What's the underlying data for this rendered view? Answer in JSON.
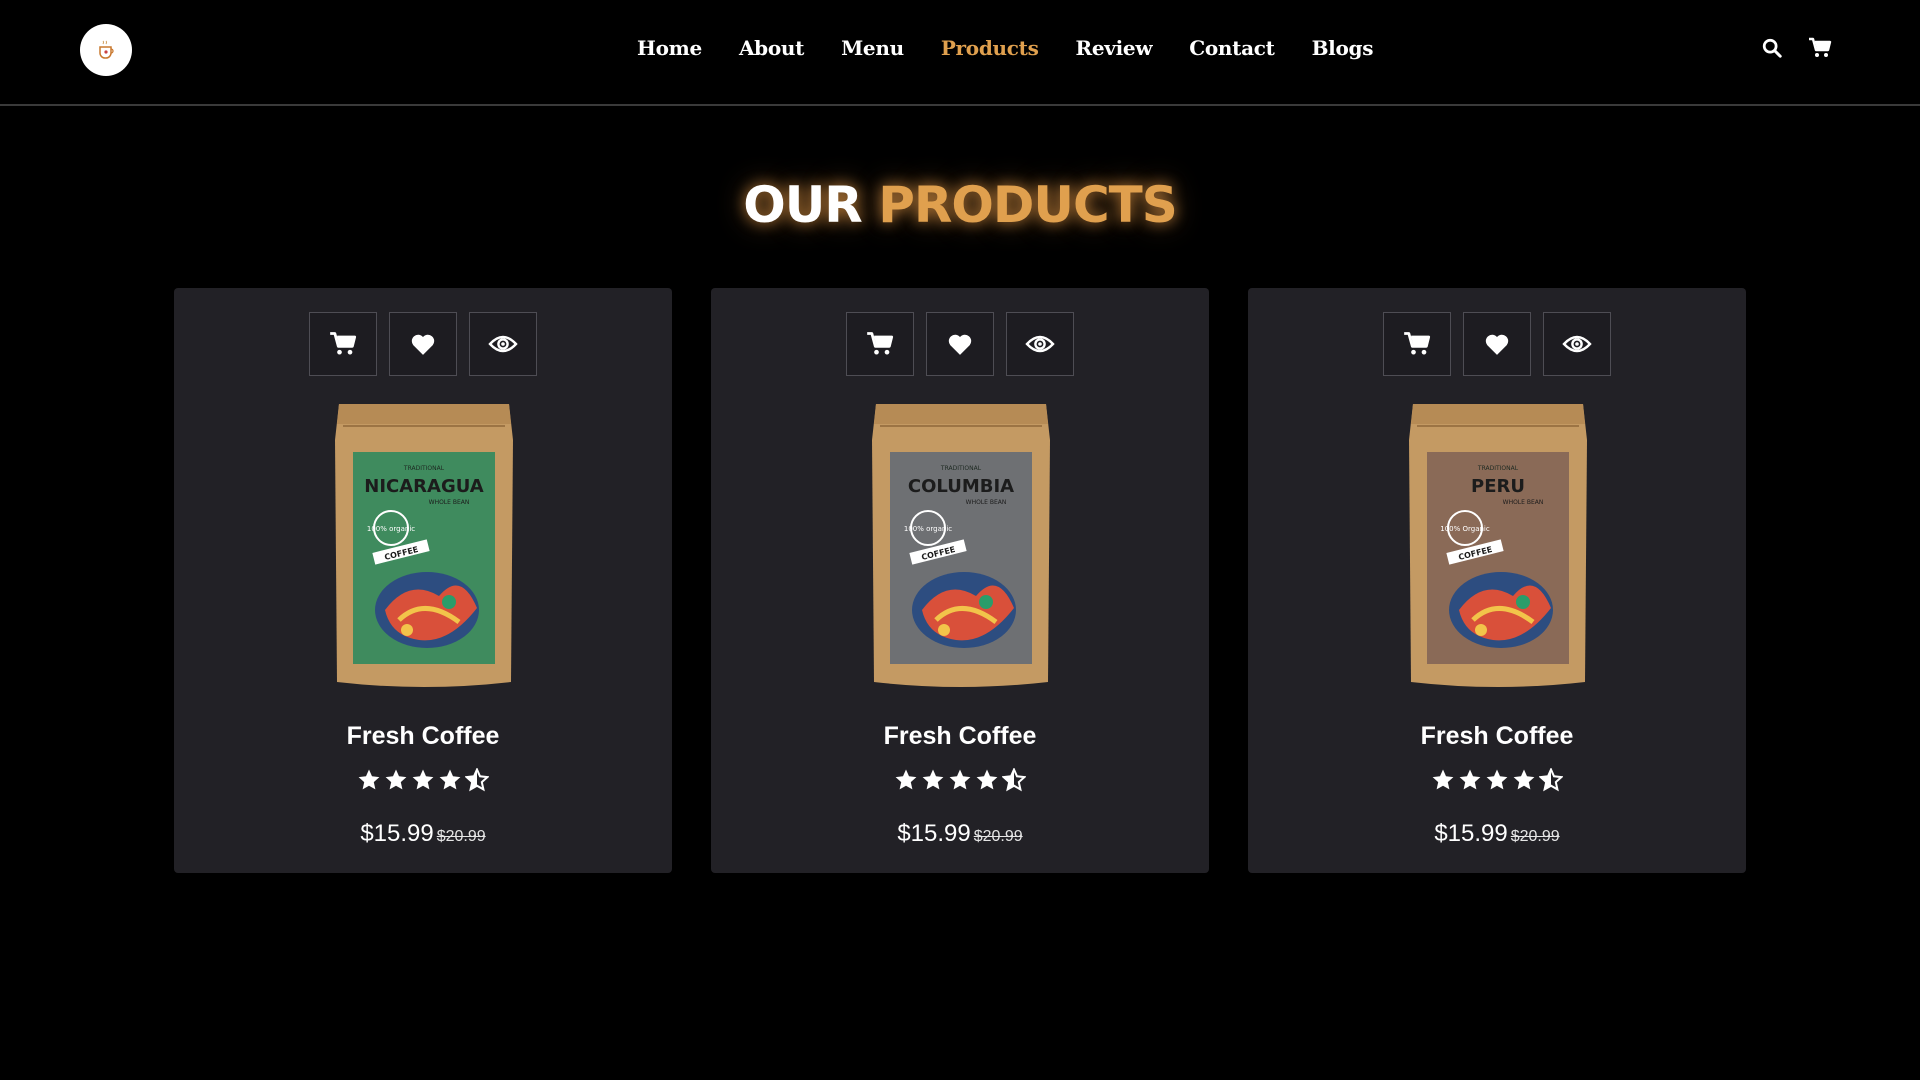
{
  "header": {
    "nav": [
      {
        "label": "Home",
        "active": false
      },
      {
        "label": "About",
        "active": false
      },
      {
        "label": "Menu",
        "active": false
      },
      {
        "label": "Products",
        "active": true
      },
      {
        "label": "Review",
        "active": false
      },
      {
        "label": "Contact",
        "active": false
      },
      {
        "label": "Blogs",
        "active": false
      }
    ],
    "icons": [
      "search-icon",
      "cart-icon"
    ]
  },
  "section": {
    "title_part1": "OUR",
    "title_part2": "PRODUCTS"
  },
  "products": [
    {
      "bag_label": "NICARAGUA",
      "bag_sub": "WHOLE BEAN",
      "bag_badge": "100% organic",
      "bag_ribbon": "COFFEE",
      "name": "Fresh Coffee",
      "rating": 4.5,
      "price": "$15.99",
      "old_price": "$20.99"
    },
    {
      "bag_label": "COLUMBIA",
      "bag_sub": "WHOLE BEAN",
      "bag_badge": "100% organic",
      "bag_ribbon": "COFFEE",
      "name": "Fresh Coffee",
      "rating": 4.5,
      "price": "$15.99",
      "old_price": "$20.99"
    },
    {
      "bag_label": "PERU",
      "bag_sub": "WHOLE BEAN",
      "bag_badge": "100% Organic",
      "bag_ribbon": "COFFEE",
      "name": "Fresh Coffee",
      "rating": 4.5,
      "price": "$15.99",
      "old_price": "$20.99"
    }
  ],
  "colors": {
    "background": "#000000",
    "card": "#222126",
    "accent": "#e0a04e",
    "kraft": "#c7a06b",
    "label_green": "#3f8b5e",
    "label_grey": "#6e7073",
    "label_brown": "#8a6a57"
  }
}
